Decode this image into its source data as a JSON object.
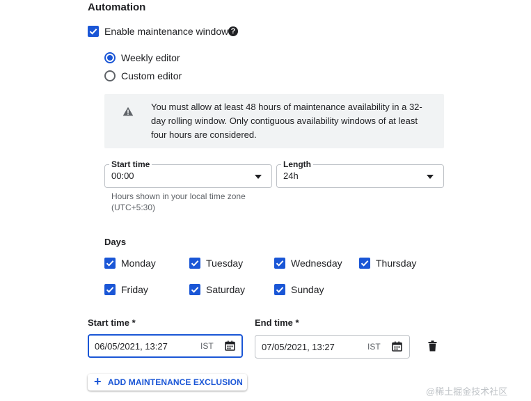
{
  "section_title": "Automation",
  "enable_maintenance": {
    "label": "Enable maintenance window",
    "checked": true,
    "help_icon": "help-icon"
  },
  "editor_mode": {
    "options": [
      {
        "label": "Weekly editor",
        "selected": true
      },
      {
        "label": "Custom editor",
        "selected": false
      }
    ]
  },
  "notice": {
    "icon": "warning-icon",
    "text": "You must allow at least 48 hours of maintenance availability in a 32-day rolling window. Only contiguous availability windows of at least four hours are considered."
  },
  "start_time": {
    "label": "Start time",
    "value": "00:00"
  },
  "length": {
    "label": "Length",
    "value": "24h"
  },
  "timezone_hint": "Hours shown in your local time zone (UTC+5:30)",
  "days": {
    "title": "Days",
    "items": [
      {
        "label": "Monday",
        "checked": true
      },
      {
        "label": "Tuesday",
        "checked": true
      },
      {
        "label": "Wednesday",
        "checked": true
      },
      {
        "label": "Thursday",
        "checked": true
      },
      {
        "label": "Friday",
        "checked": true
      },
      {
        "label": "Saturday",
        "checked": true
      },
      {
        "label": "Sunday",
        "checked": true
      }
    ]
  },
  "exclusion": {
    "start_label": "Start time *",
    "start_value": "06/05/2021, 13:27",
    "start_tz": "IST",
    "end_label": "End time *",
    "end_value": "07/05/2021, 13:27",
    "end_tz": "IST"
  },
  "add_button": {
    "label": "ADD MAINTENANCE EXCLUSION"
  },
  "watermark": "@稀土掘金技术社区",
  "colors": {
    "accent": "#1a56d6",
    "notice_bg": "#f1f3f4",
    "text": "#202124",
    "muted": "#5f6368"
  }
}
